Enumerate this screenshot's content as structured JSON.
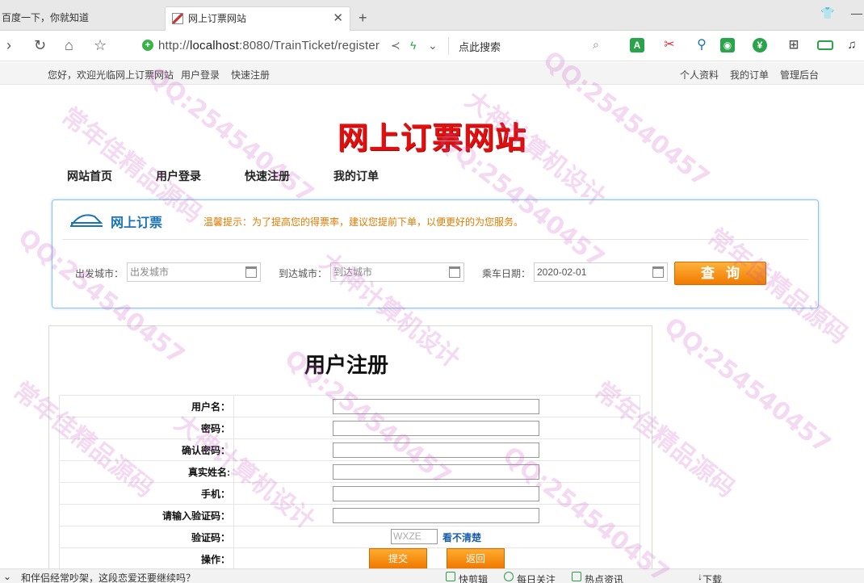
{
  "browser": {
    "tabs": [
      {
        "label": "百度一下，你就知道",
        "active": false
      },
      {
        "label": "网上订票网站",
        "active": true
      }
    ],
    "url_prefix": "http://",
    "url_host": "localhost",
    "url_path": ":8080/TrainTicket/register",
    "search_placeholder": "点此搜索",
    "icons": {
      "back": "chevron-right-icon",
      "reload": "reload-icon",
      "home": "home-icon",
      "bookmark": "star-icon",
      "share": "share-icon",
      "lightning": "lightning-icon",
      "dropdown": "chevron-down-icon",
      "search": "search-icon"
    }
  },
  "site_topbar": {
    "welcome": "您好，欢迎光临网上订票网站",
    "login": "用户登录",
    "register": "快速注册",
    "profile": "个人资料",
    "orders": "我的订单",
    "admin": "管理后台"
  },
  "site": {
    "title": "网上订票网站",
    "nav": [
      "网站首页",
      "用户登录",
      "快速注册",
      "我的订单"
    ]
  },
  "ticket_search": {
    "title": "网上订票",
    "tip": "温馨提示：为了提高您的得票率，建议您提前下单，以便更好的为您服务。",
    "from_label": "出发城市：",
    "from_placeholder": "出发城市",
    "to_label": "到达城市：",
    "to_placeholder": "到达城市",
    "date_label": "乘车日期：",
    "date_value": "2020-02-01",
    "query_button": "查询"
  },
  "register": {
    "title": "用户注册",
    "fields": [
      {
        "label": "用户名："
      },
      {
        "label": "密码："
      },
      {
        "label": "确认密码："
      },
      {
        "label": "真实姓名:"
      },
      {
        "label": "手机："
      },
      {
        "label": "请输入验证码："
      }
    ],
    "captcha_label": "验证码：",
    "captcha_value": "WXZE",
    "captcha_refresh": "看不清楚",
    "action_label": "操作：",
    "submit_button": "提交",
    "back_button": "返回"
  },
  "statusbar": {
    "news": "和伴侣经常吵架，这段恋爱还要继续吗？",
    "item1": "快剪辑",
    "item2": "每日关注",
    "item3": "热点资讯",
    "download": "下载"
  },
  "watermarks": [
    "QQ:254540457",
    "大神计算机设计",
    "常年佳精品源码"
  ],
  "colors": {
    "site_title": "#e01010",
    "accent_blue": "#1a73b8",
    "button_orange": "#f07a00",
    "tip_orange": "#e07a00"
  }
}
